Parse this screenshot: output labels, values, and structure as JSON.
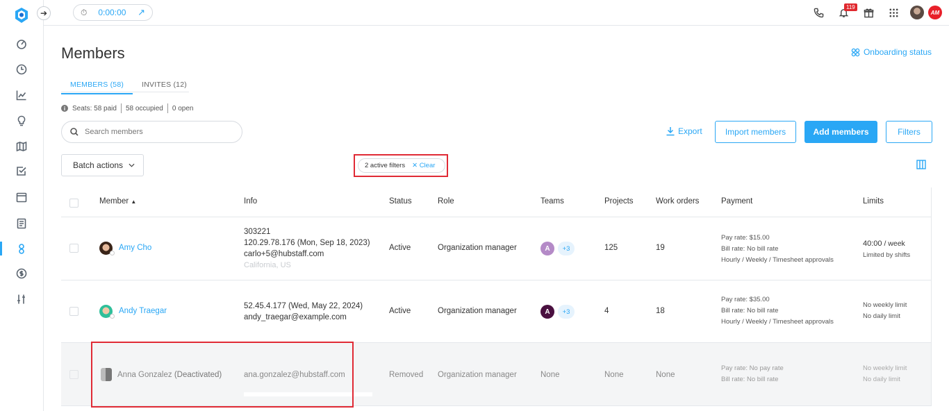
{
  "topbar": {
    "timer_value": "0:00:00",
    "notification_count": "119",
    "user_initials": "AM"
  },
  "page": {
    "title": "Members",
    "onboarding_link": "Onboarding status"
  },
  "tabs": [
    {
      "label": "MEMBERS (58)",
      "active": true
    },
    {
      "label": "INVITES (12)",
      "active": false
    }
  ],
  "seats": {
    "paid": "Seats: 58 paid",
    "occupied": "58 occupied",
    "open": "0 open"
  },
  "search": {
    "placeholder": "Search members"
  },
  "actions": {
    "export": "Export",
    "import": "Import members",
    "add": "Add members",
    "filters": "Filters",
    "batch": "Batch actions"
  },
  "active_filters": {
    "label": "2 active filters",
    "clear": "Clear"
  },
  "table": {
    "headers": {
      "member": "Member",
      "info": "Info",
      "status": "Status",
      "role": "Role",
      "teams": "Teams",
      "projects": "Projects",
      "work_orders": "Work orders",
      "payment": "Payment",
      "limits": "Limits"
    },
    "rows": [
      {
        "name": "Amy Cho",
        "info_1": "303221",
        "info_2": "120.29.78.176 (Mon, Sep 18, 2023)",
        "info_3": "carlo+5@hubstaff.com",
        "info_4": "California, US",
        "status": "Active",
        "role": "Organization manager",
        "team_initial": "A",
        "team_more": "+3",
        "projects": "125",
        "work_orders": "19",
        "pay_rate": "Pay rate: $15.00",
        "bill_rate": "Bill rate: No bill rate",
        "pay_type": "Hourly / Weekly / Timesheet approvals",
        "limit_1_value": "40:00",
        "limit_1_suffix": " / week",
        "limit_2": "Limited by shifts",
        "team_color": "#b48ac7"
      },
      {
        "name": "Andy Traegar",
        "info_1": "52.45.4.177 (Wed, May 22, 2024)",
        "info_2": "andy_traegar@example.com",
        "status": "Active",
        "role": "Organization manager",
        "team_initial": "A",
        "team_more": "+3",
        "projects": "4",
        "work_orders": "18",
        "pay_rate": "Pay rate: $35.00",
        "bill_rate": "Bill rate: No bill rate",
        "pay_type": "Hourly / Weekly / Timesheet approvals",
        "limit_1": "No weekly limit",
        "limit_2": "No daily limit",
        "team_color": "#4a1040"
      },
      {
        "name": "Anna Gonzalez",
        "name_suffix": "(Deactivated)",
        "info_1": "ana.gonzalez@hubstaff.com",
        "status": "Removed",
        "role": "Organization manager",
        "teams": "None",
        "projects": "None",
        "work_orders": "None",
        "pay_rate": "Pay rate: No pay rate",
        "bill_rate": "Bill rate: No bill rate",
        "limit_1": "No weekly limit",
        "limit_2": "No daily limit"
      }
    ]
  },
  "colors": {
    "accent": "#2aa7f5",
    "highlight": "#e02a35"
  }
}
